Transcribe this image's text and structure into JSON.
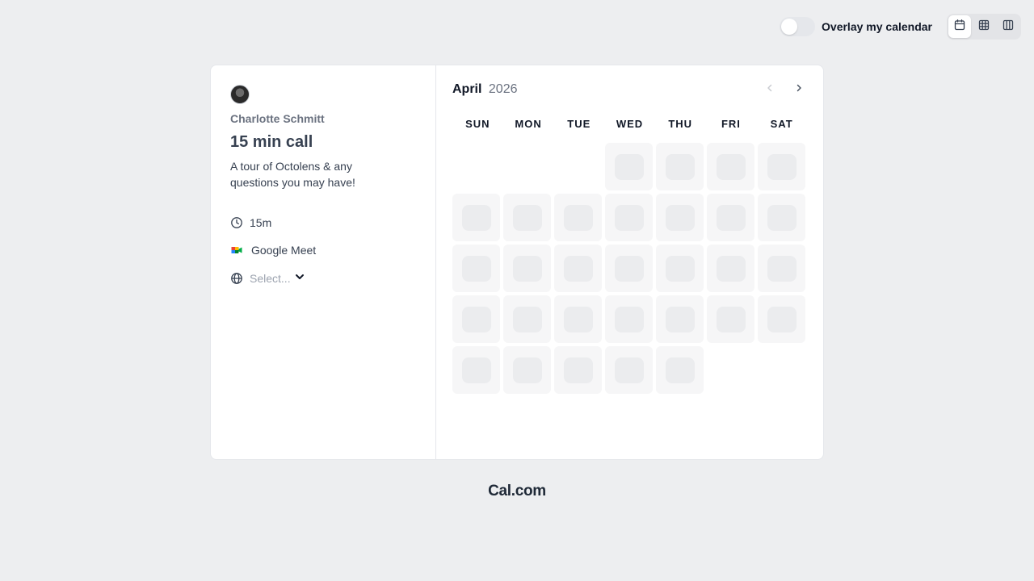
{
  "topbar": {
    "overlay_label": "Overlay my calendar",
    "overlay_enabled": false,
    "views": [
      {
        "icon": "calendar-month-icon",
        "active": true
      },
      {
        "icon": "grid-icon",
        "active": false
      },
      {
        "icon": "columns-icon",
        "active": false
      }
    ]
  },
  "event": {
    "host_name": "Charlotte Schmitt",
    "title": "15 min call",
    "description": "A tour of Octolens & any questions you may have!",
    "duration": "15m",
    "location": "Google Meet",
    "timezone_placeholder": "Select..."
  },
  "calendar": {
    "month": "April",
    "year": "2026",
    "weekdays": [
      "SUN",
      "MON",
      "TUE",
      "WED",
      "THU",
      "FRI",
      "SAT"
    ],
    "leading_empty_days": 3,
    "days_in_month": 30,
    "loading": true
  },
  "footer": {
    "brand": "Cal.com"
  },
  "colors": {
    "background": "#edeef0",
    "day_cell": "#f6f6f7",
    "skeleton": "#ebecee"
  }
}
